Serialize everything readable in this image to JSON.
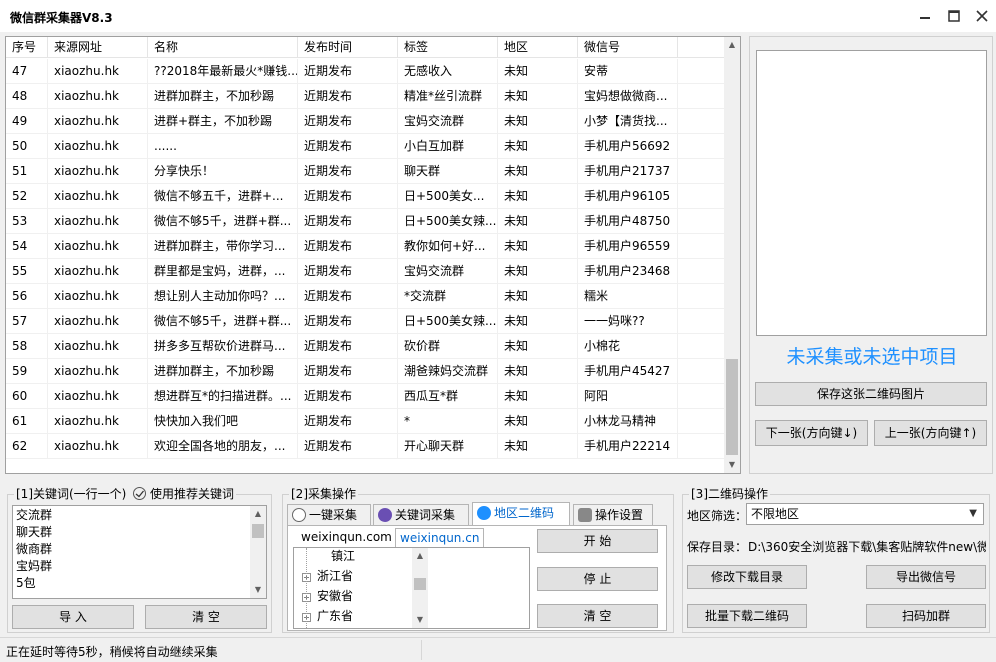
{
  "window": {
    "title": "微信群采集器V8.3"
  },
  "table": {
    "headers": [
      "序号",
      "来源网址",
      "名称",
      "发布时间",
      "标签",
      "地区",
      "微信号"
    ],
    "rows": [
      [
        "47",
        "xiaozhu.hk",
        "??2018年最新最火*赚钱...",
        "近期发布",
        "无感收入",
        "未知",
        "安蒂"
      ],
      [
        "48",
        "xiaozhu.hk",
        "进群加群主，不加秒踢",
        "近期发布",
        "精准*丝引流群",
        "未知",
        "宝妈想做微商..."
      ],
      [
        "49",
        "xiaozhu.hk",
        "进群+群主，不加秒踢",
        "近期发布",
        "宝妈交流群",
        "未知",
        "小梦【清货找..."
      ],
      [
        "50",
        "xiaozhu.hk",
        "......",
        "近期发布",
        "小白互加群",
        "未知",
        "手机用户56692"
      ],
      [
        "51",
        "xiaozhu.hk",
        "分享快乐！",
        "近期发布",
        "聊天群",
        "未知",
        "手机用户21737"
      ],
      [
        "52",
        "xiaozhu.hk",
        "微信不够五千，进群+...",
        "近期发布",
        "日+500美女...",
        "未知",
        "手机用户96105"
      ],
      [
        "53",
        "xiaozhu.hk",
        "微信不够5千，进群+群...",
        "近期发布",
        "日+500美女辣...",
        "未知",
        "手机用户48750"
      ],
      [
        "54",
        "xiaozhu.hk",
        "进群加群主，带你学习...",
        "近期发布",
        "教你如何+好...",
        "未知",
        "手机用户96559"
      ],
      [
        "55",
        "xiaozhu.hk",
        "群里都是宝妈，进群，...",
        "近期发布",
        "宝妈交流群",
        "未知",
        "手机用户23468"
      ],
      [
        "56",
        "xiaozhu.hk",
        "想让别人主动加你吗？...",
        "近期发布",
        "*交流群",
        "未知",
        "糯米"
      ],
      [
        "57",
        "xiaozhu.hk",
        "微信不够5千，进群+群...",
        "近期发布",
        "日+500美女辣...",
        "未知",
        "一一妈咪??"
      ],
      [
        "58",
        "xiaozhu.hk",
        "拼多多互帮砍价进群马...",
        "近期发布",
        "砍价群",
        "未知",
        "小棉花"
      ],
      [
        "59",
        "xiaozhu.hk",
        "进群加群主，不加秒踢",
        "近期发布",
        "潮爸辣妈交流群",
        "未知",
        "手机用户45427"
      ],
      [
        "60",
        "xiaozhu.hk",
        "想进群互*的扫描进群。...",
        "近期发布",
        "西瓜互*群",
        "未知",
        "阿阳"
      ],
      [
        "61",
        "xiaozhu.hk",
        "快快加入我们吧",
        "近期发布",
        "*",
        "未知",
        "小林龙马精神"
      ],
      [
        "62",
        "xiaozhu.hk",
        "欢迎全国各地的朋友，...",
        "近期发布",
        "开心聊天群",
        "未知",
        "手机用户22214"
      ]
    ]
  },
  "qr": {
    "message": "未采集或未选中项目",
    "save_label": "保存这张二维码图片",
    "next_label": "下一张(方向键↓)",
    "prev_label": "上一张(方向键↑)"
  },
  "keywords": {
    "group_label": "[1]关键词(一行一个)",
    "recommend_label": "使用推荐关键词",
    "items": [
      "交流群",
      "聊天群",
      "微商群",
      "宝妈群",
      "5包"
    ],
    "import_label": "导 入",
    "clear_label": "清 空"
  },
  "collect": {
    "group_label": "[2]采集操作",
    "tabs": [
      "一键采集",
      "关键词采集",
      "地区二维码",
      "操作设置"
    ],
    "sites": [
      "weixinqun.com",
      "weixinqun.cn"
    ],
    "tree_top": "镇江",
    "tree_items": [
      "浙江省",
      "安徽省",
      "广东省"
    ],
    "start_label": "开 始",
    "stop_label": "停 止",
    "clear_label": "清 空"
  },
  "qrops": {
    "group_label": "[3]二维码操作",
    "region_label": "地区筛选：",
    "region_value": "不限地区",
    "dir_label": "保存目录：",
    "dir_value": "D:\\360安全浏览器下载\\集客贴牌软件new\\微",
    "modify_dir_label": "修改下载目录",
    "export_label": "导出微信号",
    "batch_label": "批量下载二维码",
    "scan_label": "扫码加群"
  },
  "status": {
    "text": "正在延时等待5秒，稍候将自动继续采集"
  },
  "colors": {
    "accent": "#1e90ff",
    "link_tab": "#0066cc"
  }
}
